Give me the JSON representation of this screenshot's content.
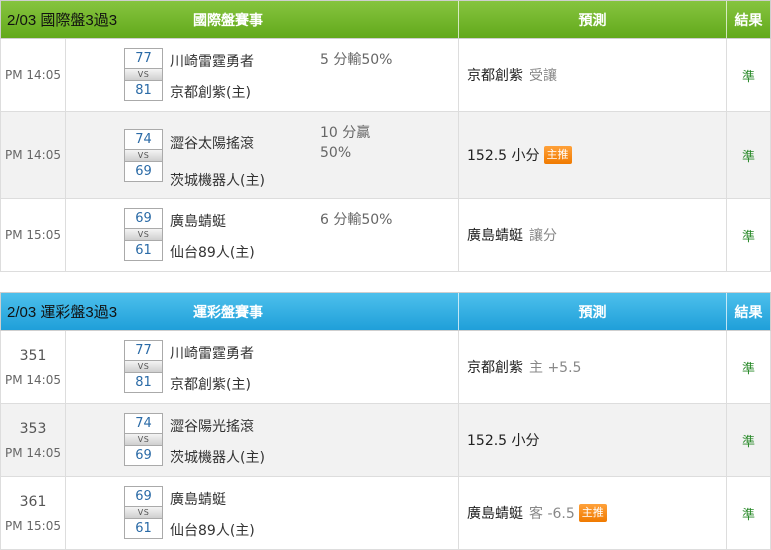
{
  "colors": {
    "green_header": "#6cb326",
    "blue_header": "#2aa9e0",
    "result_green": "#2a8a2a",
    "tag_orange": "#f38400"
  },
  "tables": [
    {
      "date": "2/03 國際盤3過3",
      "event_header": "國際盤賽事",
      "pred_header": "預測",
      "result_header": "結果",
      "rows": [
        {
          "code": "",
          "time": "PM 14:05",
          "score_top": "77",
          "score_bottom": "81",
          "vs": "VS",
          "team_away": "川崎雷霆勇者",
          "team_home": "京都創紫(主)",
          "odds_line1": "5 分輸50%",
          "odds_line2": "",
          "pred_team": "京都創紫",
          "pred_tail": "受讓",
          "tag": "",
          "result": "準"
        },
        {
          "code": "",
          "time": "PM 14:05",
          "score_top": "74",
          "score_bottom": "69",
          "vs": "VS",
          "team_away": "澀谷太陽搖滾",
          "team_home": "茨城機器人(主)",
          "odds_line1": "10 分贏",
          "odds_line2": "50%",
          "pred_team": "152.5 小分",
          "pred_tail": "",
          "tag": "主推",
          "result": "準"
        },
        {
          "code": "",
          "time": "PM 15:05",
          "score_top": "69",
          "score_bottom": "61",
          "vs": "VS",
          "team_away": "廣島蜻蜓",
          "team_home": "仙台89人(主)",
          "odds_line1": "6 分輸50%",
          "odds_line2": "",
          "pred_team": "廣島蜻蜓",
          "pred_tail": "讓分",
          "tag": "",
          "result": "準"
        }
      ]
    },
    {
      "date": "2/03 運彩盤3過3",
      "event_header": "運彩盤賽事",
      "pred_header": "預測",
      "result_header": "結果",
      "rows": [
        {
          "code": "351",
          "time": "PM 14:05",
          "score_top": "77",
          "score_bottom": "81",
          "vs": "VS",
          "team_away": "川崎雷霆勇者",
          "team_home": "京都創紫(主)",
          "odds_line1": "",
          "odds_line2": "",
          "pred_team": "京都創紫",
          "pred_tail": "主 +5.5",
          "tag": "",
          "result": "準"
        },
        {
          "code": "353",
          "time": "PM 14:05",
          "score_top": "74",
          "score_bottom": "69",
          "vs": "VS",
          "team_away": "澀谷陽光搖滾",
          "team_home": "茨城機器人(主)",
          "odds_line1": "",
          "odds_line2": "",
          "pred_team": "152.5 小分",
          "pred_tail": "",
          "tag": "",
          "result": "準"
        },
        {
          "code": "361",
          "time": "PM 15:05",
          "score_top": "69",
          "score_bottom": "61",
          "vs": "VS",
          "team_away": "廣島蜻蜓",
          "team_home": "仙台89人(主)",
          "odds_line1": "",
          "odds_line2": "",
          "pred_team": "廣島蜻蜓",
          "pred_tail": "客 -6.5",
          "tag": "主推",
          "result": "準"
        }
      ]
    }
  ]
}
